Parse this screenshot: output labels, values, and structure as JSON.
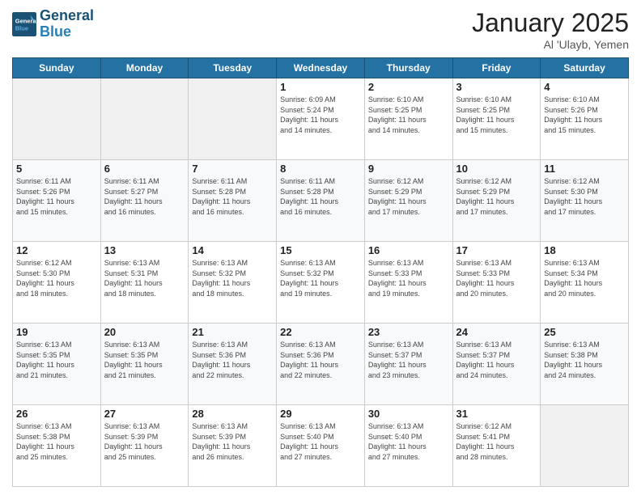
{
  "logo": {
    "line1": "General",
    "line2": "Blue"
  },
  "title": "January 2025",
  "subtitle": "Al 'Ulayb, Yemen",
  "weekdays": [
    "Sunday",
    "Monday",
    "Tuesday",
    "Wednesday",
    "Thursday",
    "Friday",
    "Saturday"
  ],
  "weeks": [
    [
      {
        "day": "",
        "info": ""
      },
      {
        "day": "",
        "info": ""
      },
      {
        "day": "",
        "info": ""
      },
      {
        "day": "1",
        "info": "Sunrise: 6:09 AM\nSunset: 5:24 PM\nDaylight: 11 hours\nand 14 minutes."
      },
      {
        "day": "2",
        "info": "Sunrise: 6:10 AM\nSunset: 5:25 PM\nDaylight: 11 hours\nand 14 minutes."
      },
      {
        "day": "3",
        "info": "Sunrise: 6:10 AM\nSunset: 5:25 PM\nDaylight: 11 hours\nand 15 minutes."
      },
      {
        "day": "4",
        "info": "Sunrise: 6:10 AM\nSunset: 5:26 PM\nDaylight: 11 hours\nand 15 minutes."
      }
    ],
    [
      {
        "day": "5",
        "info": "Sunrise: 6:11 AM\nSunset: 5:26 PM\nDaylight: 11 hours\nand 15 minutes."
      },
      {
        "day": "6",
        "info": "Sunrise: 6:11 AM\nSunset: 5:27 PM\nDaylight: 11 hours\nand 16 minutes."
      },
      {
        "day": "7",
        "info": "Sunrise: 6:11 AM\nSunset: 5:28 PM\nDaylight: 11 hours\nand 16 minutes."
      },
      {
        "day": "8",
        "info": "Sunrise: 6:11 AM\nSunset: 5:28 PM\nDaylight: 11 hours\nand 16 minutes."
      },
      {
        "day": "9",
        "info": "Sunrise: 6:12 AM\nSunset: 5:29 PM\nDaylight: 11 hours\nand 17 minutes."
      },
      {
        "day": "10",
        "info": "Sunrise: 6:12 AM\nSunset: 5:29 PM\nDaylight: 11 hours\nand 17 minutes."
      },
      {
        "day": "11",
        "info": "Sunrise: 6:12 AM\nSunset: 5:30 PM\nDaylight: 11 hours\nand 17 minutes."
      }
    ],
    [
      {
        "day": "12",
        "info": "Sunrise: 6:12 AM\nSunset: 5:30 PM\nDaylight: 11 hours\nand 18 minutes."
      },
      {
        "day": "13",
        "info": "Sunrise: 6:13 AM\nSunset: 5:31 PM\nDaylight: 11 hours\nand 18 minutes."
      },
      {
        "day": "14",
        "info": "Sunrise: 6:13 AM\nSunset: 5:32 PM\nDaylight: 11 hours\nand 18 minutes."
      },
      {
        "day": "15",
        "info": "Sunrise: 6:13 AM\nSunset: 5:32 PM\nDaylight: 11 hours\nand 19 minutes."
      },
      {
        "day": "16",
        "info": "Sunrise: 6:13 AM\nSunset: 5:33 PM\nDaylight: 11 hours\nand 19 minutes."
      },
      {
        "day": "17",
        "info": "Sunrise: 6:13 AM\nSunset: 5:33 PM\nDaylight: 11 hours\nand 20 minutes."
      },
      {
        "day": "18",
        "info": "Sunrise: 6:13 AM\nSunset: 5:34 PM\nDaylight: 11 hours\nand 20 minutes."
      }
    ],
    [
      {
        "day": "19",
        "info": "Sunrise: 6:13 AM\nSunset: 5:35 PM\nDaylight: 11 hours\nand 21 minutes."
      },
      {
        "day": "20",
        "info": "Sunrise: 6:13 AM\nSunset: 5:35 PM\nDaylight: 11 hours\nand 21 minutes."
      },
      {
        "day": "21",
        "info": "Sunrise: 6:13 AM\nSunset: 5:36 PM\nDaylight: 11 hours\nand 22 minutes."
      },
      {
        "day": "22",
        "info": "Sunrise: 6:13 AM\nSunset: 5:36 PM\nDaylight: 11 hours\nand 22 minutes."
      },
      {
        "day": "23",
        "info": "Sunrise: 6:13 AM\nSunset: 5:37 PM\nDaylight: 11 hours\nand 23 minutes."
      },
      {
        "day": "24",
        "info": "Sunrise: 6:13 AM\nSunset: 5:37 PM\nDaylight: 11 hours\nand 24 minutes."
      },
      {
        "day": "25",
        "info": "Sunrise: 6:13 AM\nSunset: 5:38 PM\nDaylight: 11 hours\nand 24 minutes."
      }
    ],
    [
      {
        "day": "26",
        "info": "Sunrise: 6:13 AM\nSunset: 5:38 PM\nDaylight: 11 hours\nand 25 minutes."
      },
      {
        "day": "27",
        "info": "Sunrise: 6:13 AM\nSunset: 5:39 PM\nDaylight: 11 hours\nand 25 minutes."
      },
      {
        "day": "28",
        "info": "Sunrise: 6:13 AM\nSunset: 5:39 PM\nDaylight: 11 hours\nand 26 minutes."
      },
      {
        "day": "29",
        "info": "Sunrise: 6:13 AM\nSunset: 5:40 PM\nDaylight: 11 hours\nand 27 minutes."
      },
      {
        "day": "30",
        "info": "Sunrise: 6:13 AM\nSunset: 5:40 PM\nDaylight: 11 hours\nand 27 minutes."
      },
      {
        "day": "31",
        "info": "Sunrise: 6:12 AM\nSunset: 5:41 PM\nDaylight: 11 hours\nand 28 minutes."
      },
      {
        "day": "",
        "info": ""
      }
    ]
  ]
}
